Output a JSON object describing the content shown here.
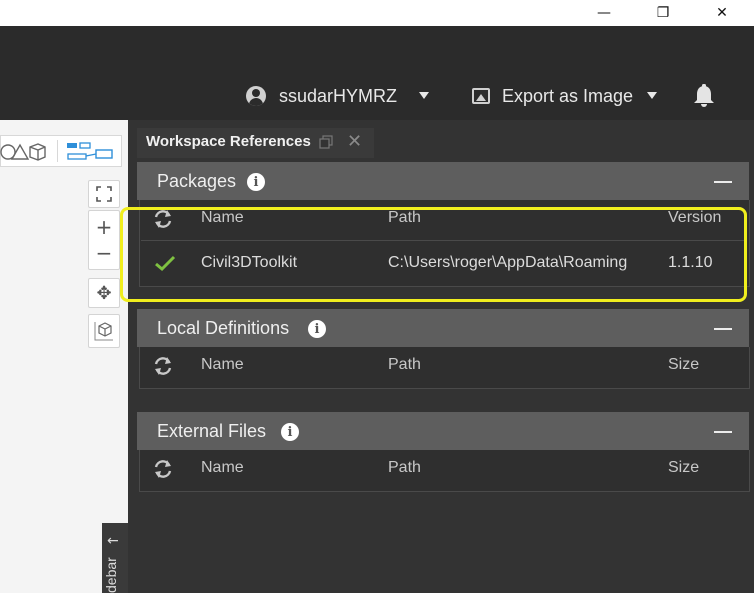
{
  "window": {
    "minimize_glyph": "—",
    "maximize_glyph": "❐",
    "close_glyph": "✕"
  },
  "header": {
    "username": "ssudarHYMRZ",
    "export_label": "Export as Image",
    "icons": [
      "user-icon",
      "export-image-icon",
      "bell-icon"
    ]
  },
  "canvas": {
    "zoom_in": "+",
    "zoom_out": "−",
    "pan": "✥",
    "sidebar_label": "debar",
    "sidebar_arrow": "←"
  },
  "panel": {
    "title": "Workspace References",
    "close_glyph": "✕",
    "sections": [
      {
        "title": "Packages",
        "columns": [
          "Name",
          "Path",
          "Version"
        ],
        "rows": [
          {
            "name": "Civil3DToolkit",
            "path": "C:\\Users\\roger\\AppData\\Roaming",
            "version": "1.1.10"
          }
        ]
      },
      {
        "title": "Local Definitions",
        "columns": [
          "Name",
          "Path",
          "Size"
        ],
        "rows": []
      },
      {
        "title": "External Files",
        "columns": [
          "Name",
          "Path",
          "Size"
        ],
        "rows": []
      }
    ]
  },
  "colors": {
    "highlight": "#f0ee1e",
    "check": "#7fc241",
    "section_header": "#5e5e5e"
  }
}
